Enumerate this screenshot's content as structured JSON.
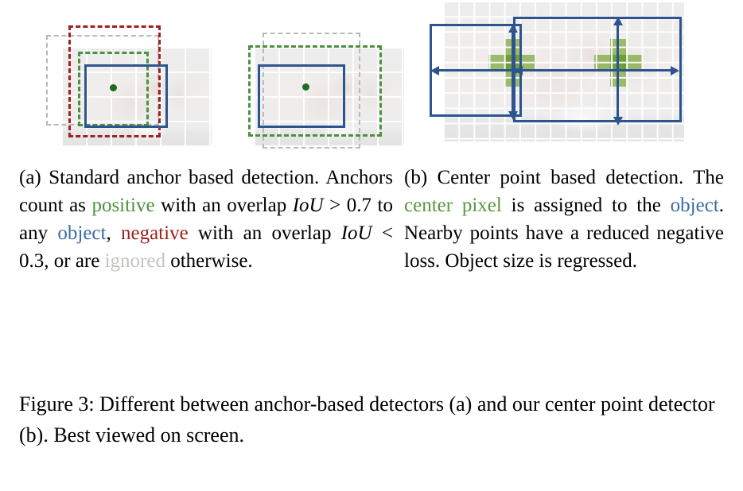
{
  "figure": {
    "id": "figure-3",
    "caption_prefix": "Figure 3:",
    "caption_text": " Different between anchor-based detectors (a) and our center point detector (b). Best viewed on screen."
  },
  "panel_a": {
    "label": "(a)",
    "subcaption_parts": {
      "p1": "(a) Standard anchor based detection. Anchors count as ",
      "positive": "positive",
      "p2": " with an overlap ",
      "math1": "IoU",
      "p3": " > 0.7 to any ",
      "object": "object",
      "p4": ", ",
      "negative": "negative",
      "p5": " with an overlap ",
      "math2": "IoU",
      "p6": " < 0.3, or are ",
      "ignored": "ignored",
      "p7": " otherwise."
    },
    "images": [
      {
        "name": "anchor-example-left",
        "alt": "faded cat photograph with grid overlay"
      },
      {
        "name": "anchor-example-right",
        "alt": "faded cat photograph with grid overlay"
      }
    ],
    "annotations": {
      "blue_box_role": "ground-truth object box",
      "red_dashed_role": "negative anchor",
      "green_dashed_role": "positive anchor",
      "gray_dashed_role": "ignored anchor",
      "green_dot_role": "object center point"
    }
  },
  "panel_b": {
    "label": "(b)",
    "subcaption_parts": {
      "p1": "(b) Center point based detection. The ",
      "center_pixel": "center pixel",
      "p2": " is assigned to the ",
      "object": "object",
      "p3": ". Nearby points have a reduced negative loss. Object size is regressed."
    },
    "images": [
      {
        "name": "centerpoint-example",
        "alt": "faded cat photograph with grid overlay"
      }
    ],
    "annotations": {
      "blue_box_role": "predicted object box",
      "green_cross_role": "center pixel and reduced-penalty neighbours",
      "arrow_role": "regressed object size"
    }
  },
  "colors": {
    "positive_green": "#4d9140",
    "negative_red": "#9e2222",
    "object_blue": "#3a6ba5",
    "ignored_gray": "#c3c3c0",
    "box_blue": "#2e5490",
    "center_dot_green": "#1f6b1f",
    "cell_light_green": "#7aa63a",
    "cell_dark_green": "#5c9222",
    "background": "#ffffff"
  }
}
